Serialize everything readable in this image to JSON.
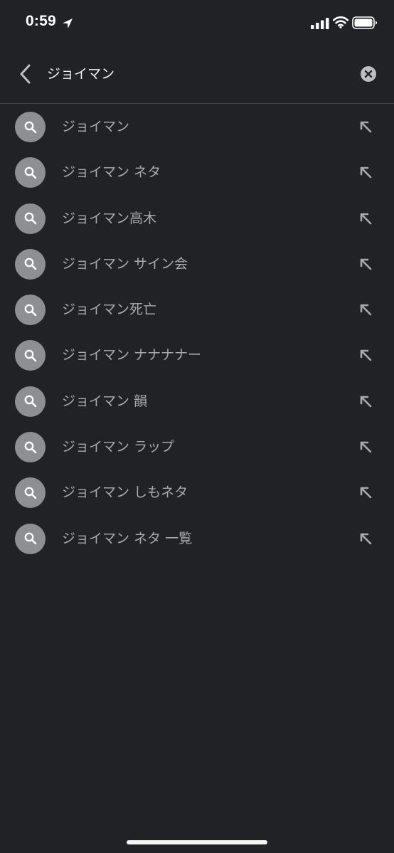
{
  "status_bar": {
    "time": "0:59"
  },
  "search": {
    "query": "ジョイマン"
  },
  "suggestions": [
    {
      "label": "ジョイマン"
    },
    {
      "label": "ジョイマン ネタ"
    },
    {
      "label": "ジョイマン高木"
    },
    {
      "label": "ジョイマン サイン会"
    },
    {
      "label": "ジョイマン死亡"
    },
    {
      "label": "ジョイマン ナナナナー"
    },
    {
      "label": "ジョイマン 韻"
    },
    {
      "label": "ジョイマン ラップ"
    },
    {
      "label": "ジョイマン しもネタ"
    },
    {
      "label": "ジョイマン ネタ 一覧"
    }
  ],
  "icons": {
    "back": "chevron-left-icon",
    "clear": "clear-circle-x-icon",
    "suggestion": "search-icon",
    "fill_query": "arrow-up-left-icon"
  },
  "colors": {
    "background": "#212226",
    "divider": "#44454a",
    "suggestion_icon_bg": "#8e8f93",
    "suggestion_text": "#a9aaad"
  }
}
